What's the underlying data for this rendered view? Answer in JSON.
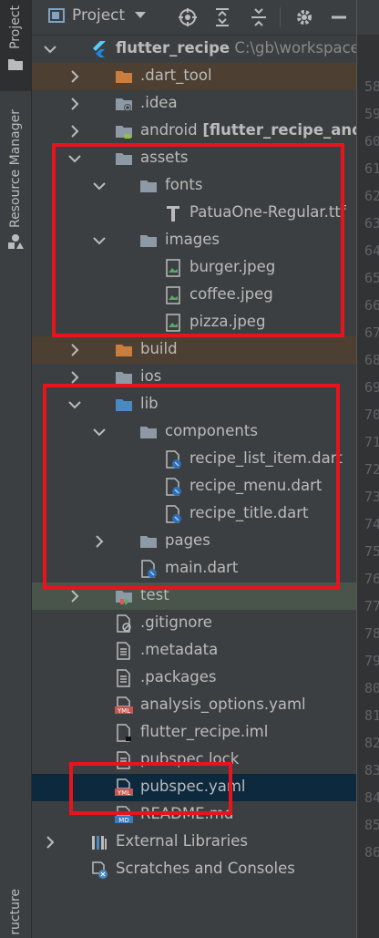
{
  "tool_strip": {
    "project_tab": "Project",
    "resource_manager_tab": "Resource Manager",
    "structure_tab": "ructure"
  },
  "toolbar": {
    "project_selector_label": "Project"
  },
  "tree": [
    {
      "label": "flutter_recipe",
      "path": "C:\\gb\\workspace\\f",
      "icon": "flutter-icon",
      "expanded": true
    },
    {
      "label": ".dart_tool",
      "icon": "excluded-folder-icon",
      "expanded": false
    },
    {
      "label": ".idea",
      "icon": "settings-folder-icon",
      "expanded": false
    },
    {
      "label": "android",
      "module": "[flutter_recipe_android]",
      "icon": "android-folder-icon",
      "expanded": false
    },
    {
      "label": "assets",
      "icon": "folder-icon",
      "expanded": true
    },
    {
      "label": "fonts",
      "icon": "folder-icon",
      "expanded": true
    },
    {
      "label": "PatuaOne-Regular.ttf",
      "icon": "font-file-icon"
    },
    {
      "label": "images",
      "icon": "folder-icon",
      "expanded": true
    },
    {
      "label": "burger.jpeg",
      "icon": "image-file-icon"
    },
    {
      "label": "coffee.jpeg",
      "icon": "image-file-icon"
    },
    {
      "label": "pizza.jpeg",
      "icon": "image-file-icon"
    },
    {
      "label": "build",
      "icon": "excluded-folder-icon",
      "expanded": false
    },
    {
      "label": "ios",
      "icon": "folder-icon",
      "expanded": false
    },
    {
      "label": "lib",
      "icon": "source-folder-icon",
      "expanded": true
    },
    {
      "label": "components",
      "icon": "folder-icon",
      "expanded": true
    },
    {
      "label": "recipe_list_item.dart",
      "icon": "dart-file-icon"
    },
    {
      "label": "recipe_menu.dart",
      "icon": "dart-file-icon"
    },
    {
      "label": "recipe_title.dart",
      "icon": "dart-file-icon"
    },
    {
      "label": "pages",
      "icon": "folder-icon",
      "expanded": false
    },
    {
      "label": "main.dart",
      "icon": "dart-file-icon"
    },
    {
      "label": "test",
      "icon": "test-folder-icon",
      "expanded": false
    },
    {
      "label": ".gitignore",
      "icon": "ignore-file-icon"
    },
    {
      "label": ".metadata",
      "icon": "text-file-icon"
    },
    {
      "label": ".packages",
      "icon": "text-file-icon"
    },
    {
      "label": "analysis_options.yaml",
      "icon": "yaml-file-icon"
    },
    {
      "label": "flutter_recipe.iml",
      "icon": "iml-file-icon"
    },
    {
      "label": "pubspec.lock",
      "icon": "text-file-icon"
    },
    {
      "label": "pubspec.yaml",
      "icon": "yaml-file-icon"
    },
    {
      "label": "README.md",
      "icon": "markdown-file-icon"
    },
    {
      "label": "External Libraries",
      "icon": "libraries-icon",
      "expanded": false
    },
    {
      "label": "Scratches and Consoles",
      "icon": "scratches-icon"
    }
  ],
  "line_numbers": [
    "58",
    "59",
    "60",
    "61",
    "62",
    "63",
    "64",
    "65",
    "66",
    "67",
    "68",
    "69",
    "70",
    "71",
    "72",
    "73",
    "74",
    "75",
    "76",
    "77",
    "78",
    "79",
    "80",
    "81",
    "82",
    "83",
    "84",
    "85",
    "86"
  ],
  "colors": {
    "background": "#3c3f41",
    "excluded_row": "#4d3f31",
    "selected_row": "#0d293e",
    "test_row": "#49544a",
    "annotation_red": "#e8141c",
    "folder": "#8d9aa6",
    "source_folder": "#4a89c1",
    "excluded_folder": "#c97d3f"
  }
}
